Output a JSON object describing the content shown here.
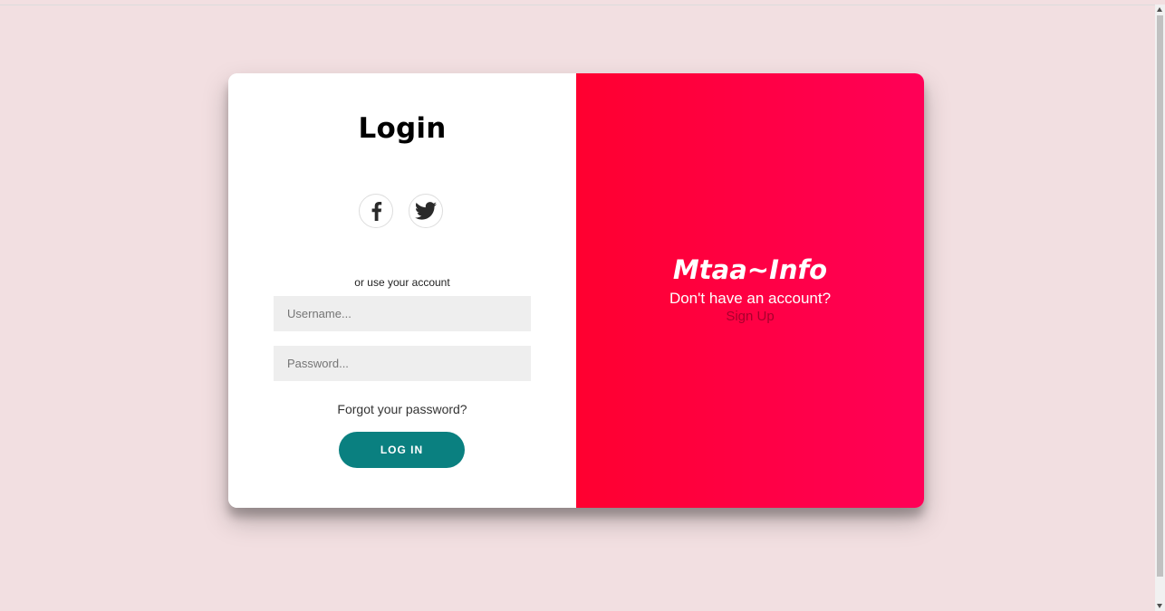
{
  "login": {
    "title": "Login",
    "social": [
      "facebook-icon",
      "twitter-icon"
    ],
    "divider_text": "or use your account",
    "username_placeholder": "Username...",
    "username_value": "",
    "password_placeholder": "Password...",
    "password_value": "",
    "forgot_label": "Forgot your password?",
    "submit_label": "LOG IN"
  },
  "overlay": {
    "brand": "Mtaa~Info",
    "prompt": "Don't have an account?",
    "signup_label": "Sign Up"
  },
  "colors": {
    "background": "#f2dfe1",
    "overlay_start": "#ff0030",
    "overlay_end": "#ff0057",
    "button": "#0a8080",
    "signup_link": "#a8002c"
  }
}
